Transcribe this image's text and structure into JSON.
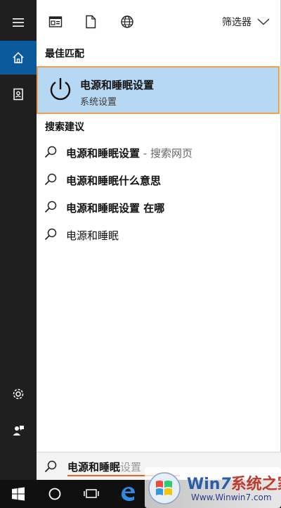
{
  "filter": {
    "label": "筛选器"
  },
  "sections": {
    "best_match": "最佳匹配",
    "suggestions": "搜索建议"
  },
  "best_match_item": {
    "title": "电源和睡眠设置",
    "subtitle": "系统设置"
  },
  "suggestions": [
    {
      "bold": "电源和睡眠设置",
      "muted": " - 搜索网页"
    },
    {
      "bold": "电源和睡眠什么意思",
      "muted": ""
    },
    {
      "bold": "电源和睡眠设置 在哪",
      "muted": ""
    },
    {
      "bold": "电源和睡眠",
      "muted": ""
    }
  ],
  "search": {
    "typed": "电源和睡眠",
    "ghost": "设置"
  },
  "watermark": {
    "brand_prefix": "Win",
    "brand_num": "7",
    "brand_suffix": "系统之家",
    "url": "Www.Winwin7.com"
  },
  "colors": {
    "accent": "#0b5a9c",
    "highlight": "#b6d8f3",
    "highlight_border": "#f0a04b",
    "underline": "#e3661c"
  }
}
